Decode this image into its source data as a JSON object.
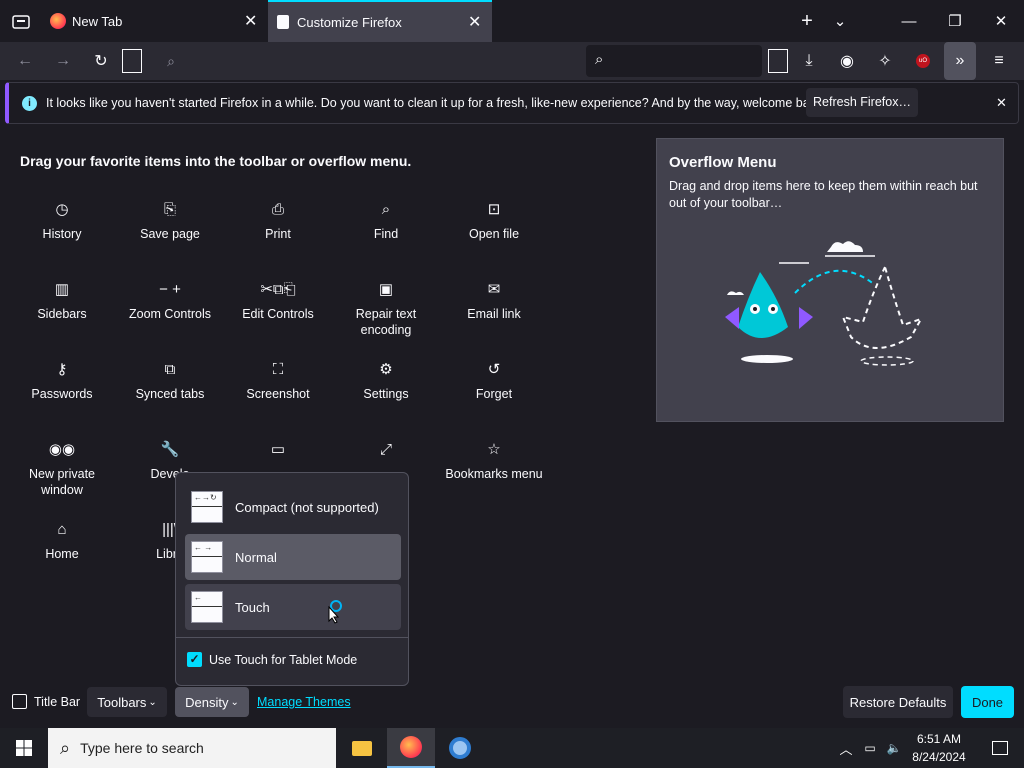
{
  "tabs": [
    {
      "label": "New Tab",
      "icon": "firefox-icon"
    },
    {
      "label": "Customize Firefox",
      "icon": "brush-icon"
    }
  ],
  "notification": {
    "message": "It looks like you haven't started Firefox in a while. Do you want to clean it up for a fresh, like-new experience? And by the way, welcome back!",
    "button": "Refresh Firefox…"
  },
  "palette": {
    "title": "Drag your favorite items into the toolbar or overflow menu.",
    "items": [
      {
        "label": "History",
        "icon": "history-icon"
      },
      {
        "label": "Save page",
        "icon": "save-page-icon"
      },
      {
        "label": "Print",
        "icon": "print-icon"
      },
      {
        "label": "Find",
        "icon": "find-icon"
      },
      {
        "label": "Open file",
        "icon": "open-file-icon"
      },
      {
        "label": "Sidebars",
        "icon": "sidebars-icon"
      },
      {
        "label": "Zoom Controls",
        "icon": "zoom-controls-icon"
      },
      {
        "label": "Edit Controls",
        "icon": "edit-controls-icon"
      },
      {
        "label": "Repair text encoding",
        "icon": "repair-encoding-icon"
      },
      {
        "label": "Email link",
        "icon": "email-icon"
      },
      {
        "label": "Passwords",
        "icon": "key-icon"
      },
      {
        "label": "Synced tabs",
        "icon": "synced-tabs-icon"
      },
      {
        "label": "Screenshot",
        "icon": "screenshot-icon"
      },
      {
        "label": "Settings",
        "icon": "gear-icon"
      },
      {
        "label": "Forget",
        "icon": "forget-icon"
      },
      {
        "label": "New private window",
        "icon": "private-mask-icon"
      },
      {
        "label": "Develo",
        "icon": "wrench-icon"
      },
      {
        "label": "",
        "icon": "window-icon"
      },
      {
        "label": "",
        "icon": "fullscreen-icon"
      },
      {
        "label": "Bookmarks menu",
        "icon": "bookmarks-menu-icon"
      },
      {
        "label": "Home",
        "icon": "home-icon"
      },
      {
        "label": "Libra",
        "icon": "library-icon"
      }
    ]
  },
  "overflow": {
    "title": "Overflow Menu",
    "description": "Drag and drop items here to keep them within reach but out of your toolbar…"
  },
  "footer": {
    "title_bar": "Title Bar",
    "toolbars": "Toolbars",
    "density": "Density",
    "manage_themes": "Manage Themes",
    "restore": "Restore Defaults",
    "done": "Done"
  },
  "density_menu": {
    "options": [
      {
        "label": "Compact (not supported)",
        "selected": false
      },
      {
        "label": "Normal",
        "selected": true
      },
      {
        "label": "Touch",
        "selected": false
      }
    ],
    "touch_tablet": "Use Touch for Tablet Mode",
    "touch_tablet_checked": true
  },
  "taskbar": {
    "search_placeholder": "Type here to search",
    "time": "6:51 AM",
    "date": "8/24/2024"
  },
  "colors": {
    "accent": "#00ddff",
    "private": "#9059ff"
  }
}
